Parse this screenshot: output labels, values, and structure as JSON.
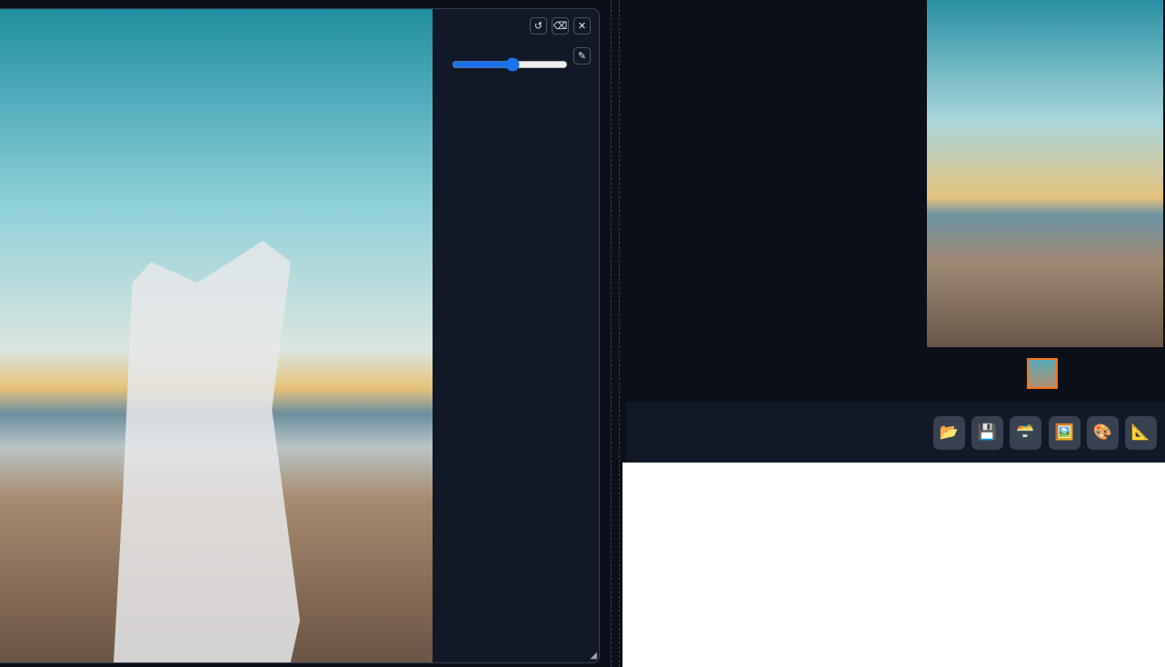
{
  "editor": {
    "buttons": {
      "undo_icon": "undo-icon",
      "clear_icon": "eraser-icon",
      "close_icon": "close-icon",
      "brush_icon": "brush-icon"
    },
    "brush_size_fraction": 0.53,
    "accent": "#1a73e8"
  },
  "gallery": {
    "selected_thumbnail_border": "#f97316"
  },
  "toolbar": {
    "buttons": [
      {
        "icon": "open-folder-icon",
        "glyph": "📂"
      },
      {
        "icon": "save-icon",
        "glyph": "💾"
      },
      {
        "icon": "card-file-box-icon",
        "glyph": "🗃️"
      },
      {
        "icon": "framed-picture-icon",
        "glyph": "🖼️"
      },
      {
        "icon": "palette-icon",
        "glyph": "🎨"
      },
      {
        "icon": "triangular-ruler-icon",
        "glyph": "📐"
      }
    ]
  }
}
